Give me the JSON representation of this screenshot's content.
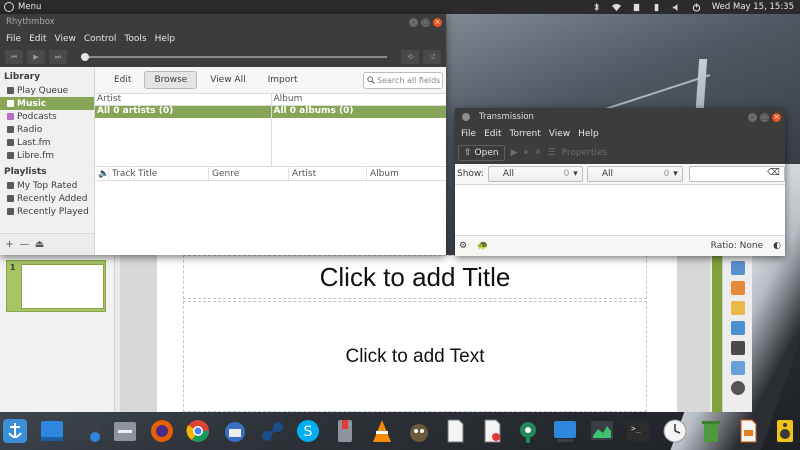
{
  "top_panel": {
    "menu_label": "Menu",
    "datetime": "Wed May 15, 15:35",
    "tray_icons": [
      "bluetooth-icon",
      "wifi-icon",
      "clipboard-icon",
      "battery-icon",
      "volume-icon",
      "power-icon"
    ]
  },
  "rhythmbox": {
    "title": "Rhythmbox",
    "menu": [
      "File",
      "Edit",
      "View",
      "Control",
      "Tools",
      "Help"
    ],
    "player_buttons": [
      "previous-icon",
      "play-icon",
      "next-icon"
    ],
    "sidebar": {
      "library_heading": "Library",
      "library_items": [
        {
          "label": "Play Queue",
          "icon": "queue-icon",
          "active": false
        },
        {
          "label": "Music",
          "icon": "music-icon",
          "active": true
        },
        {
          "label": "Podcasts",
          "icon": "podcast-icon",
          "active": false
        },
        {
          "label": "Radio",
          "icon": "radio-icon",
          "active": false
        },
        {
          "label": "Last.fm",
          "icon": "lastfm-icon",
          "active": false
        },
        {
          "label": "Libre.fm",
          "icon": "librefm-icon",
          "active": false
        }
      ],
      "playlists_heading": "Playlists",
      "playlist_items": [
        {
          "label": "My Top Rated",
          "icon": "folder-icon"
        },
        {
          "label": "Recently Added",
          "icon": "folder-icon"
        },
        {
          "label": "Recently Played",
          "icon": "folder-icon"
        }
      ],
      "footer_buttons": [
        "+",
        "—",
        "⏏"
      ]
    },
    "toolbar": {
      "edit": "Edit",
      "browse": "Browse",
      "view_all": "View All",
      "import": "Import",
      "search_placeholder": "Search all fields"
    },
    "browser": {
      "artist_header": "Artist",
      "album_header": "Album",
      "artist_all": "All 0 artists (0)",
      "album_all": "All 0 albums (0)"
    },
    "track_columns": [
      "Track",
      "Title",
      "Genre",
      "Artist",
      "Album"
    ]
  },
  "transmission": {
    "title": "Transmission",
    "menu": [
      "File",
      "Edit",
      "Torrent",
      "View",
      "Help"
    ],
    "toolbar": {
      "open": "Open",
      "properties": "Properties"
    },
    "filter": {
      "show_label": "Show:",
      "combo1_value": "All",
      "combo1_count": "0",
      "combo2_value": "All",
      "combo2_count": "0"
    },
    "ratio": "Ratio: None"
  },
  "impress": {
    "slide_number": "1",
    "title_placeholder": "Click to add Title",
    "text_placeholder": "Click to add Text"
  },
  "dock": {
    "items": [
      "anchor-icon",
      "desktop-icon",
      "screenshot-icon",
      "files-icon",
      "firefox-icon",
      "chrome-icon",
      "thunderbird-icon",
      "steam-icon",
      "skype-icon",
      "archive-icon",
      "vlc-icon",
      "gimp-icon",
      "document-icon",
      "editor-icon",
      "settings-gear-icon",
      "display-icon",
      "monitor-icon",
      "terminal-icon",
      "clock-icon",
      "trash-icon",
      "presentation-icon",
      "speaker-icon"
    ]
  },
  "colors": {
    "accent_green": "#87a556",
    "panel_dark": "#3c3c3c",
    "close_orange": "#e95420"
  }
}
